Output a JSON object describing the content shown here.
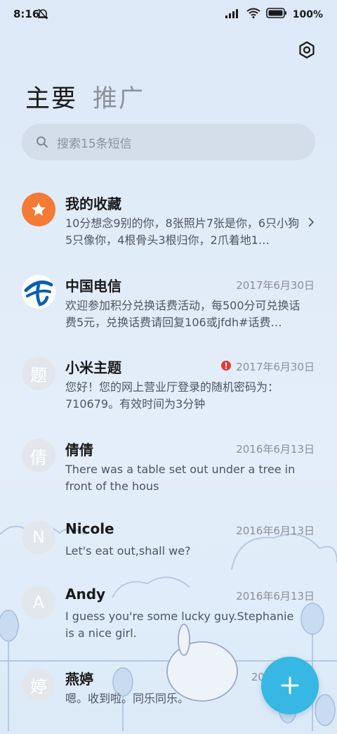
{
  "status": {
    "time": "8:16",
    "battery": "100%"
  },
  "tabs": [
    {
      "label": "主要"
    },
    {
      "label": "推广"
    }
  ],
  "search": {
    "placeholder": "搜索15条短信"
  },
  "conversations": [
    {
      "name": "我的收藏",
      "date": "",
      "preview": "10分想念9别的你，8张照片7张是你，6只小狗5只像你，4根骨头3根归你，2爪着地1…",
      "avatar_type": "star-icon"
    },
    {
      "name": "中国电信",
      "date": "2017年6月30日",
      "preview": "欢迎参加积分兑换话费活动，每500分可兑换话费5元，兑换话费请回复106或jfdh#话费…",
      "avatar_type": "china-telecom-logo"
    },
    {
      "name": "小米主题",
      "date": "2017年6月30日",
      "preview": "您好！您的网上营业厅登录的随机密码为：710679。有效时间为3分钟",
      "avatar_letter": "题",
      "error": true
    },
    {
      "name": "倩倩",
      "date": "2016年6月13日",
      "preview": "There was a table set out under a tree in front of the hous",
      "avatar_letter": "倩"
    },
    {
      "name": "Nicole",
      "date": "2016年6月13日",
      "preview": "Let's eat out,shall we?",
      "avatar_letter": "N"
    },
    {
      "name": "Andy",
      "date": "2016年6月13日",
      "preview": "I guess you're some lucky guy.Stephanie is a nice girl.",
      "avatar_letter": "A"
    },
    {
      "name": "燕婷",
      "date": "2013",
      "preview": "嗯。收到啦。同乐同乐。",
      "avatar_letter": "婷"
    }
  ],
  "colors": {
    "accent": "#36b7e4",
    "star_avatar": "#f47a35",
    "error": "#e53935"
  }
}
